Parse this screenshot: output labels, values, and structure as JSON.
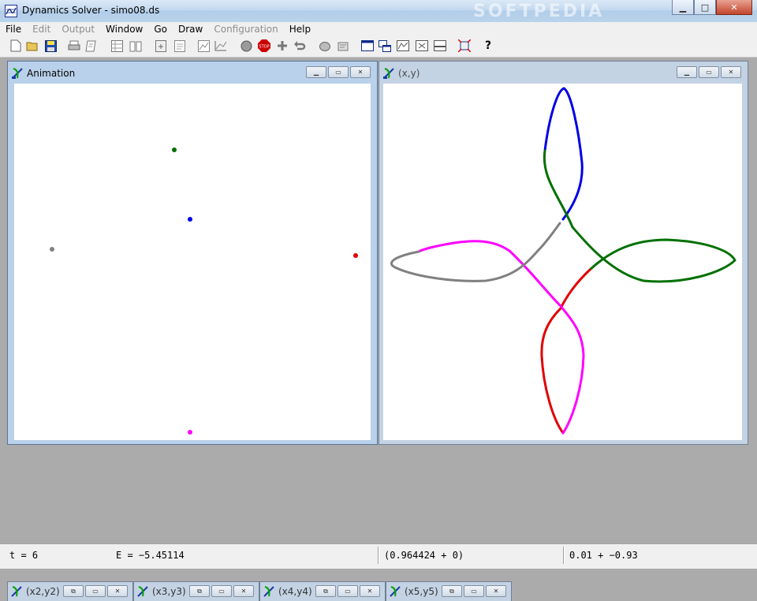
{
  "window": {
    "title": "Dynamics Solver - simo08.ds",
    "watermark": "SOFTPEDIA",
    "controls": {
      "minimize": "▁",
      "maximize": "□",
      "close": "✕"
    }
  },
  "menu": [
    {
      "label": "File",
      "enabled": true
    },
    {
      "label": "Edit",
      "enabled": false
    },
    {
      "label": "Output",
      "enabled": false
    },
    {
      "label": "Window",
      "enabled": true
    },
    {
      "label": "Go",
      "enabled": true
    },
    {
      "label": "Draw",
      "enabled": true
    },
    {
      "label": "Configuration",
      "enabled": false
    },
    {
      "label": "Help",
      "enabled": true
    }
  ],
  "toolbar": {
    "icons": [
      "new-file-icon",
      "open-folder-icon",
      "save-disk-icon",
      "print-icon",
      "print-preview-icon",
      "table-icon",
      "book-icon",
      "calculator-icon",
      "data-icon",
      "graph-icon",
      "line-chart-icon",
      "sphere-icon",
      "stop-icon",
      "add-icon",
      "undo-icon",
      "cycle-icon",
      "settings-icon",
      "window-icon",
      "cascade-icon",
      "tile-icon",
      "compare-icon",
      "split-icon",
      "fit-icon",
      "help-icon"
    ],
    "help_label": "?"
  },
  "windows": {
    "animation": {
      "title": "Animation",
      "active": true,
      "points": [
        {
          "color": "#007000",
          "label": "green"
        },
        {
          "color": "#0000e6",
          "label": "blue"
        },
        {
          "color": "#808080",
          "label": "gray"
        },
        {
          "color": "#e00000",
          "label": "red"
        },
        {
          "color": "#ff00ff",
          "label": "magenta"
        }
      ]
    },
    "xy": {
      "title": "(x,y)",
      "active": false,
      "curve_colors": [
        "#0000e6",
        "#007000",
        "#e00000",
        "#ff00ff",
        "#808080"
      ]
    }
  },
  "minimized_windows": [
    {
      "label": "(x2,y2)"
    },
    {
      "label": "(x3,y3)"
    },
    {
      "label": "(x4,y4)"
    },
    {
      "label": "(x5,y5)"
    }
  ],
  "status": {
    "time": "t = 6",
    "energy": "E = −5.45114",
    "coords": "(0.964424 + 0)",
    "cursor": "0.01 + −0.93"
  }
}
